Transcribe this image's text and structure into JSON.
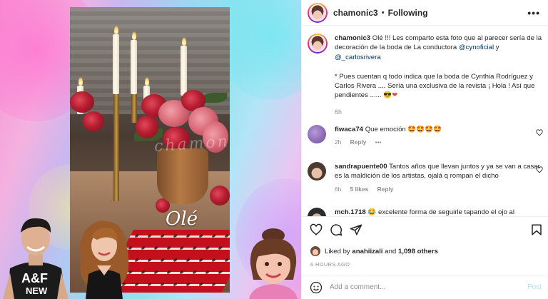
{
  "header": {
    "username": "chamonic3",
    "separator": "•",
    "follow_label": "Following",
    "more_label": "•••"
  },
  "caption": {
    "username": "chamonic3",
    "text_1": "Olé !!! Les comparto esta foto que al parecer sería de la decoración de la boda de La conductora",
    "mention_1": "@cynoficial",
    "and": "y",
    "mention_2": "@_carlosrivera",
    "text_2": "* Pues cuentan q todo indica que la boda de Cynthia Rodríguez y Carlos Rivera .... Sería una exclusiva de la revista ¡ Hola ! Así que pendientes ......",
    "emoji": "😎",
    "heart": "❤",
    "time": "6h"
  },
  "comments": [
    {
      "username": "fiwaca74",
      "text": "Que emoción 🤩🤩🤩🤩",
      "time": "2h",
      "reply": "Reply",
      "likes": "",
      "more": "—"
    },
    {
      "username": "sandrapuente00",
      "text": "Tantos años que llevan juntos y ya se van a casar es la maldición de los artistas, ojalá q rompan el dicho",
      "time": "6h",
      "likes": "5 likes",
      "reply": "Reply"
    },
    {
      "username": "mch.1718",
      "text": "😂 excelente forma de seguirle tapando el ojo al",
      "time": "",
      "reply": ""
    }
  ],
  "likes": {
    "prefix": "Liked by",
    "user": "anahiizali",
    "and": "and",
    "count": "1,098 others"
  },
  "time_ago": "6 HOURS AGO",
  "comment_input": {
    "placeholder": "Add a comment...",
    "post_label": "Post"
  },
  "photo": {
    "overlay_text": "Olé",
    "watermark": "chamonic3"
  },
  "colors": {
    "link": "#00376b",
    "muted": "#8e8e8e",
    "post_disabled": "#b2dffc",
    "heart": "#ed4956"
  },
  "icons": [
    "more-icon",
    "heart-icon",
    "comment-icon",
    "share-icon",
    "save-icon",
    "emoji-icon"
  ]
}
